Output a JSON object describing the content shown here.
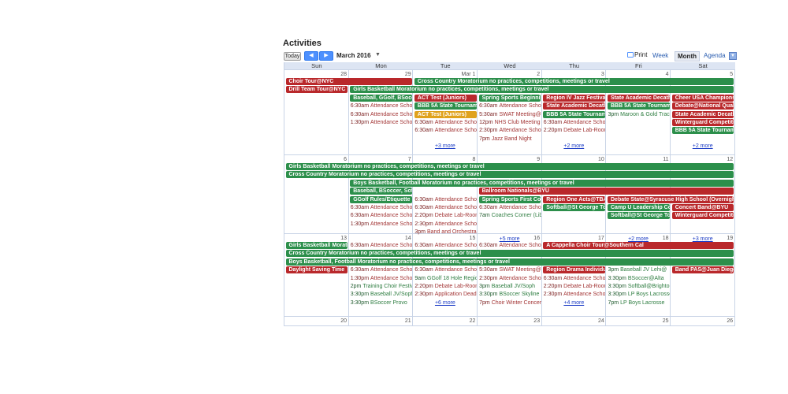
{
  "calendar": {
    "title": "Activities",
    "today_label": "Today",
    "prev_icon": "◀",
    "next_icon": "▶",
    "date_range": "March 2016",
    "range_dropdown": "▼",
    "print_label": "Print",
    "views": [
      "Week",
      "Month",
      "Agenda"
    ],
    "selected_view": "Month",
    "agenda_dropdown": "▼",
    "weekdays": [
      "Sun",
      "Mon",
      "Tue",
      "Wed",
      "Thu",
      "Fri",
      "Sat"
    ]
  },
  "colors": {
    "red": "#b9282b",
    "green": "#2c8f4b",
    "orange": "#e0a21c",
    "accent": "#4d90fe"
  },
  "weeks": [
    {
      "days": [
        "28",
        "29",
        "Mar 1",
        "2",
        "3",
        "4",
        "5"
      ],
      "more": [
        {
          "col": 2,
          "text": "+3 more"
        },
        {
          "col": 4,
          "text": "+2 more"
        },
        {
          "col": 6,
          "text": "+2 more"
        }
      ],
      "bars": [
        {
          "col": 0,
          "span": 2,
          "row": 0,
          "color": "red",
          "text": "Choir Tour@NYC"
        },
        {
          "col": 2,
          "span": 5,
          "row": 0,
          "color": "green",
          "text": "Cross Country Moratorium no practices, competitions, meetings or travel"
        },
        {
          "col": 0,
          "span": 1,
          "row": 1,
          "color": "red",
          "text": "Drill Team Tour@NYC"
        },
        {
          "col": 1,
          "span": 6,
          "row": 1,
          "color": "green",
          "text": "Girls Basketball Moratorium no practices, competitions, meetings or travel"
        },
        {
          "col": 1,
          "span": 1,
          "row": 2,
          "color": "green",
          "text": "Baseball, GGolf, BSoccer"
        },
        {
          "col": 2,
          "span": 1,
          "row": 2,
          "color": "red",
          "text": "ACT Test (Juniors)"
        },
        {
          "col": 3,
          "span": 1,
          "row": 2,
          "color": "green",
          "text": "Spring Sports Beginning"
        },
        {
          "col": 4,
          "span": 1,
          "row": 2,
          "color": "red",
          "text": "Region IV Jazz Festival"
        },
        {
          "col": 5,
          "span": 1,
          "row": 2,
          "color": "red",
          "text": "State Academic Decathlon"
        },
        {
          "col": 6,
          "span": 1,
          "row": 2,
          "color": "red",
          "text": "Cheer USA Championship"
        },
        {
          "col": 2,
          "span": 1,
          "row": 3,
          "color": "green",
          "text": "BBB 5A State Tournament"
        },
        {
          "col": 4,
          "span": 1,
          "row": 3,
          "color": "red",
          "text": "State Academic Decathlon"
        },
        {
          "col": 5,
          "span": 1,
          "row": 3,
          "color": "green",
          "text": "BBB 5A State Tournament"
        },
        {
          "col": 6,
          "span": 1,
          "row": 3,
          "color": "red",
          "text": "Debate@National Qualifier"
        },
        {
          "col": 2,
          "span": 1,
          "row": 4,
          "color": "orange",
          "text": "ACT Test (Juniors)"
        },
        {
          "col": 4,
          "span": 1,
          "row": 4,
          "color": "green",
          "text": "BBB 5A State Tournament"
        },
        {
          "col": 6,
          "span": 1,
          "row": 4,
          "color": "red",
          "text": "State Academic Decathlon"
        },
        {
          "col": 6,
          "span": 1,
          "row": 5,
          "color": "red",
          "text": "Winterguard Competition"
        },
        {
          "col": 6,
          "span": 1,
          "row": 6,
          "color": "green",
          "text": "BBB 5A State Tournament"
        }
      ],
      "events": [
        {
          "col": 1,
          "row": 3,
          "color": "red",
          "time": "6:30am",
          "text": "Attendance School"
        },
        {
          "col": 1,
          "row": 4,
          "color": "red",
          "time": "6:30am",
          "text": "Attendance School"
        },
        {
          "col": 1,
          "row": 5,
          "color": "red",
          "time": "1:30pm",
          "text": "Attendance School"
        },
        {
          "col": 2,
          "row": 5,
          "color": "red",
          "time": "6:30am",
          "text": "Attendance School"
        },
        {
          "col": 2,
          "row": 6,
          "color": "red",
          "time": "6:30am",
          "text": "Attendance School"
        },
        {
          "col": 3,
          "row": 3,
          "color": "red",
          "time": "6:30am",
          "text": "Attendance School"
        },
        {
          "col": 3,
          "row": 4,
          "color": "red",
          "time": "5:30am",
          "text": "SWAT Meeting@Library"
        },
        {
          "col": 3,
          "row": 5,
          "color": "red",
          "time": "12pm",
          "text": "NHS Club Meeting"
        },
        {
          "col": 3,
          "row": 6,
          "color": "red",
          "time": "2:30pm",
          "text": "Attendance School"
        },
        {
          "col": 3,
          "row": 7,
          "color": "red",
          "time": "7pm",
          "text": "Jazz Band Night"
        },
        {
          "col": 4,
          "row": 5,
          "color": "red",
          "time": "6:30am",
          "text": "Attendance School"
        },
        {
          "col": 4,
          "row": 6,
          "color": "red",
          "time": "2:20pm",
          "text": "Debate Lab-Room"
        },
        {
          "col": 5,
          "row": 4,
          "color": "green",
          "time": "3pm",
          "text": "Maroon & Gold Track"
        }
      ]
    },
    {
      "days": [
        "6",
        "7",
        "8",
        "9",
        "10",
        "11",
        "12"
      ],
      "more": [
        {
          "col": 3,
          "text": "+5 more"
        },
        {
          "col": 5,
          "text": "+2 more"
        },
        {
          "col": 6,
          "text": "+3 more"
        }
      ],
      "bars": [
        {
          "col": 0,
          "span": 7,
          "row": 0,
          "color": "green",
          "text": "Girls Basketball Moratorium no practices, competitions, meetings or travel"
        },
        {
          "col": 0,
          "span": 7,
          "row": 1,
          "color": "green",
          "text": "Cross Country Moratorium no practices, competitions, meetings or travel"
        },
        {
          "col": 1,
          "span": 6,
          "row": 2,
          "color": "green",
          "text": "Boys Basketball, Football Moratorium no practices, competitions, meetings or travel"
        },
        {
          "col": 1,
          "span": 1,
          "row": 3,
          "color": "green",
          "text": "Baseball, BSoccer, Softball"
        },
        {
          "col": 3,
          "span": 4,
          "row": 3,
          "color": "red",
          "text": "Ballroom Nationals@BYU"
        },
        {
          "col": 1,
          "span": 1,
          "row": 4,
          "color": "green",
          "text": "GGolf Rules/Etiquette"
        },
        {
          "col": 3,
          "span": 1,
          "row": 4,
          "color": "green",
          "text": "Spring Sports First Contest"
        },
        {
          "col": 4,
          "span": 1,
          "row": 4,
          "color": "red",
          "text": "Region One Acts@TBA"
        },
        {
          "col": 5,
          "span": 2,
          "row": 4,
          "color": "red",
          "text": "Debate State@Syracuse High School (Overnight)"
        },
        {
          "col": 4,
          "span": 1,
          "row": 5,
          "color": "green",
          "text": "Softball@St George Tournament"
        },
        {
          "col": 5,
          "span": 1,
          "row": 5,
          "color": "green",
          "text": "Camp U Leadership Conference"
        },
        {
          "col": 6,
          "span": 1,
          "row": 5,
          "color": "red",
          "text": "Concert Band@BYU"
        },
        {
          "col": 5,
          "span": 1,
          "row": 6,
          "color": "green",
          "text": "Softball@St George Tournament"
        },
        {
          "col": 6,
          "span": 1,
          "row": 6,
          "color": "red",
          "text": "Winterguard Competition"
        }
      ],
      "events": [
        {
          "col": 2,
          "row": 4,
          "color": "red",
          "time": "6:30am",
          "text": "Attendance School"
        },
        {
          "col": 2,
          "row": 5,
          "color": "red",
          "time": "6:30am",
          "text": "Attendance School"
        },
        {
          "col": 2,
          "row": 6,
          "color": "red",
          "time": "2:20pm",
          "text": "Debate Lab-Room"
        },
        {
          "col": 2,
          "row": 7,
          "color": "red",
          "time": "2:30pm",
          "text": "Attendance School"
        },
        {
          "col": 2,
          "row": 8,
          "color": "red",
          "time": "3pm",
          "text": "Band and Orchestra"
        },
        {
          "col": 1,
          "row": 5,
          "color": "red",
          "time": "6:30am",
          "text": "Attendance School"
        },
        {
          "col": 1,
          "row": 6,
          "color": "red",
          "time": "6:30am",
          "text": "Attendance School"
        },
        {
          "col": 1,
          "row": 7,
          "color": "red",
          "time": "1:30pm",
          "text": "Attendance School"
        },
        {
          "col": 3,
          "row": 5,
          "color": "red",
          "time": "6:30am",
          "text": "Attendance School"
        },
        {
          "col": 3,
          "row": 6,
          "color": "green",
          "time": "7am",
          "text": "Coaches Corner (Library)"
        }
      ]
    },
    {
      "days": [
        "13",
        "14",
        "15",
        "16",
        "17",
        "18",
        "19"
      ],
      "more": [
        {
          "col": 2,
          "text": "+6 more"
        },
        {
          "col": 4,
          "text": "+4 more"
        }
      ],
      "bars": [
        {
          "col": 0,
          "span": 1,
          "row": 0,
          "color": "green",
          "text": "Girls Basketball Moratorium"
        },
        {
          "col": 4,
          "span": 3,
          "row": 0,
          "color": "red",
          "text": "A Cappella Choir Tour@Southern Cal"
        },
        {
          "col": 0,
          "span": 7,
          "row": 1,
          "color": "green",
          "text": "Cross Country Moratorium no practices, competitions, meetings or travel"
        },
        {
          "col": 0,
          "span": 7,
          "row": 2,
          "color": "green",
          "text": "Boys Basketball, Football Moratorium no practices, competitions, meetings or travel"
        },
        {
          "col": 0,
          "span": 1,
          "row": 3,
          "color": "red",
          "text": "Daylight Saving Time"
        },
        {
          "col": 4,
          "span": 1,
          "row": 3,
          "color": "red",
          "text": "Region Drama Individuals"
        },
        {
          "col": 6,
          "span": 1,
          "row": 3,
          "color": "red",
          "text": "Band PAS@Juan Diego"
        }
      ],
      "events": [
        {
          "col": 1,
          "row": 0,
          "color": "red",
          "time": "6:30am",
          "text": "Attendance School"
        },
        {
          "col": 2,
          "row": 0,
          "color": "red",
          "time": "6:30am",
          "text": "Attendance School"
        },
        {
          "col": 3,
          "row": 0,
          "color": "red",
          "time": "6:30am",
          "text": "Attendance School"
        },
        {
          "col": 1,
          "row": 3,
          "color": "red",
          "time": "6:30am",
          "text": "Attendance School"
        },
        {
          "col": 1,
          "row": 4,
          "color": "red",
          "time": "1:30pm",
          "text": "Attendance School"
        },
        {
          "col": 1,
          "row": 5,
          "color": "green",
          "time": "2pm",
          "text": "Training Choir Festival"
        },
        {
          "col": 1,
          "row": 6,
          "color": "green",
          "time": "3:30pm",
          "text": "Baseball JV/Soph"
        },
        {
          "col": 1,
          "row": 7,
          "color": "green",
          "time": "3:30pm",
          "text": "BSoccer Provo"
        },
        {
          "col": 2,
          "row": 3,
          "color": "red",
          "time": "6:30am",
          "text": "Attendance School"
        },
        {
          "col": 2,
          "row": 4,
          "color": "green",
          "time": "9am",
          "text": "GGolf 18 Hole Region"
        },
        {
          "col": 2,
          "row": 5,
          "color": "red",
          "time": "2:20pm",
          "text": "Debate Lab-Room"
        },
        {
          "col": 2,
          "row": 6,
          "color": "red",
          "time": "2:30pm",
          "text": "Application Deadline"
        },
        {
          "col": 3,
          "row": 3,
          "color": "red",
          "time": "5:30am",
          "text": "SWAT Meeting@Library"
        },
        {
          "col": 3,
          "row": 4,
          "color": "red",
          "time": "2:30pm",
          "text": "Attendance School"
        },
        {
          "col": 3,
          "row": 5,
          "color": "green",
          "time": "3pm",
          "text": "Baseball JV/Soph"
        },
        {
          "col": 3,
          "row": 6,
          "color": "green",
          "time": "3:30pm",
          "text": "BSoccer Skyline"
        },
        {
          "col": 3,
          "row": 7,
          "color": "red",
          "time": "7pm",
          "text": "Choir Winter Concert"
        },
        {
          "col": 4,
          "row": 4,
          "color": "red",
          "time": "6:30am",
          "text": "Attendance School"
        },
        {
          "col": 4,
          "row": 5,
          "color": "red",
          "time": "2:20pm",
          "text": "Debate Lab-Room"
        },
        {
          "col": 4,
          "row": 6,
          "color": "red",
          "time": "2:30pm",
          "text": "Attendance School"
        },
        {
          "col": 5,
          "row": 3,
          "color": "green",
          "time": "3pm",
          "text": "Baseball JV Lehi@"
        },
        {
          "col": 5,
          "row": 4,
          "color": "green",
          "time": "3:30pm",
          "text": "BSoccer@Alta"
        },
        {
          "col": 5,
          "row": 5,
          "color": "green",
          "time": "3:30pm",
          "text": "Softball@Brighton"
        },
        {
          "col": 5,
          "row": 6,
          "color": "green",
          "time": "3:30pm",
          "text": "LP Boys Lacrosse"
        },
        {
          "col": 5,
          "row": 7,
          "color": "green",
          "time": "7pm",
          "text": "LP Boys Lacrosse"
        }
      ]
    },
    {
      "days": [
        "20",
        "21",
        "22",
        "23",
        "24",
        "25",
        "26"
      ],
      "more": [],
      "bars": [],
      "events": []
    }
  ]
}
